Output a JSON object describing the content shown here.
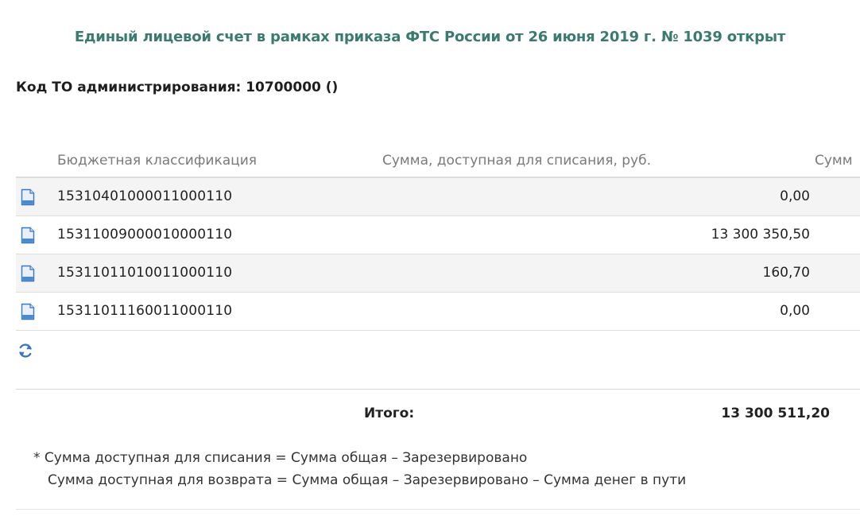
{
  "notice": "Единый лицевой счет в рамках приказа ФТС России от 26 июня 2019 г. № 1039 открыт",
  "to_code": "Код ТО администрирования: 10700000 ()",
  "table": {
    "headers": {
      "kbk": "Бюджетная классификация",
      "available": "Сумма, доступная для списания, руб.",
      "sum": "Сумм"
    },
    "rows": [
      {
        "kbk": "15310401000011000110",
        "available": "0,00"
      },
      {
        "kbk": "15311009000010000110",
        "available": "13 300 350,50"
      },
      {
        "kbk": "15311011010011000110",
        "available": "160,70"
      },
      {
        "kbk": "15311011160011000110",
        "available": "0,00"
      }
    ]
  },
  "total": {
    "label": "Итого:",
    "value": "13 300 511,20"
  },
  "notes": {
    "line1": "* Сумма доступная для списания = Сумма общая – Зарезервировано",
    "line2": "Сумма доступная для возврата = Сумма общая – Зарезервировано – Сумма денег в пути"
  },
  "icons": {
    "row_icon": "document-icon",
    "refresh_icon": "refresh-icon"
  },
  "colors": {
    "notice": "#3b7a6e",
    "icon_blue": "#3a78c0",
    "row_stripe": "#f4f4f4"
  }
}
